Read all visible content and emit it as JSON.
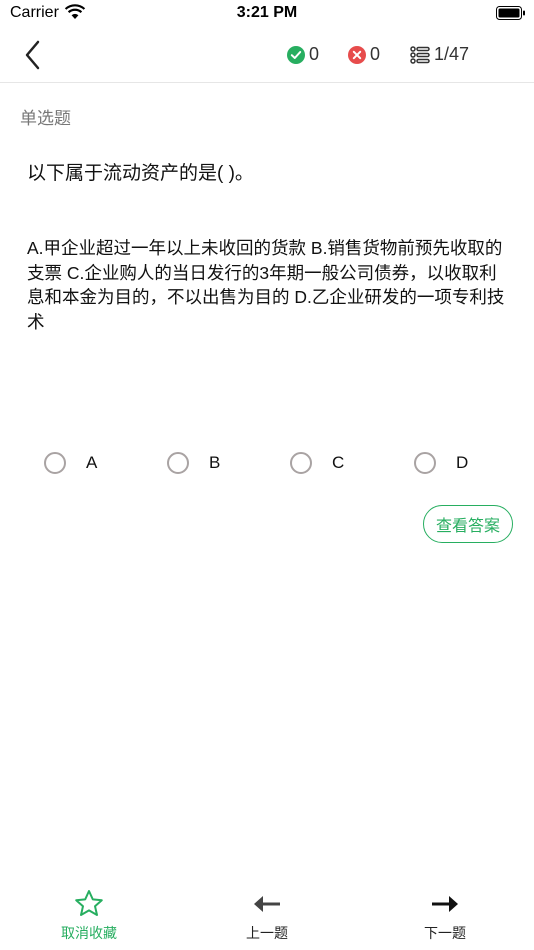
{
  "status_bar": {
    "carrier": "Carrier",
    "time": "3:21 PM"
  },
  "header": {
    "correct_count": "0",
    "wrong_count": "0",
    "progress": "1/47"
  },
  "question": {
    "type_label": "单选题",
    "text": "以下属于流动资产的是( )。",
    "options_text": "A.甲企业超过一年以上未收回的货款 B.销售货物前预先收取的支票 C.企业购人的当日发行的3年期一般公司债券，以收取利息和本金为目的，不以出售为目的 D.乙企业研发的一项专利技术"
  },
  "choices": [
    {
      "letter": "A"
    },
    {
      "letter": "B"
    },
    {
      "letter": "C"
    },
    {
      "letter": "D"
    }
  ],
  "answer_button": "查看答案",
  "bottom_bar": {
    "favorite": "取消收藏",
    "prev": "上一题",
    "next": "下一题"
  },
  "colors": {
    "accent_green": "#27ae60",
    "error_red": "#e74c4c"
  }
}
